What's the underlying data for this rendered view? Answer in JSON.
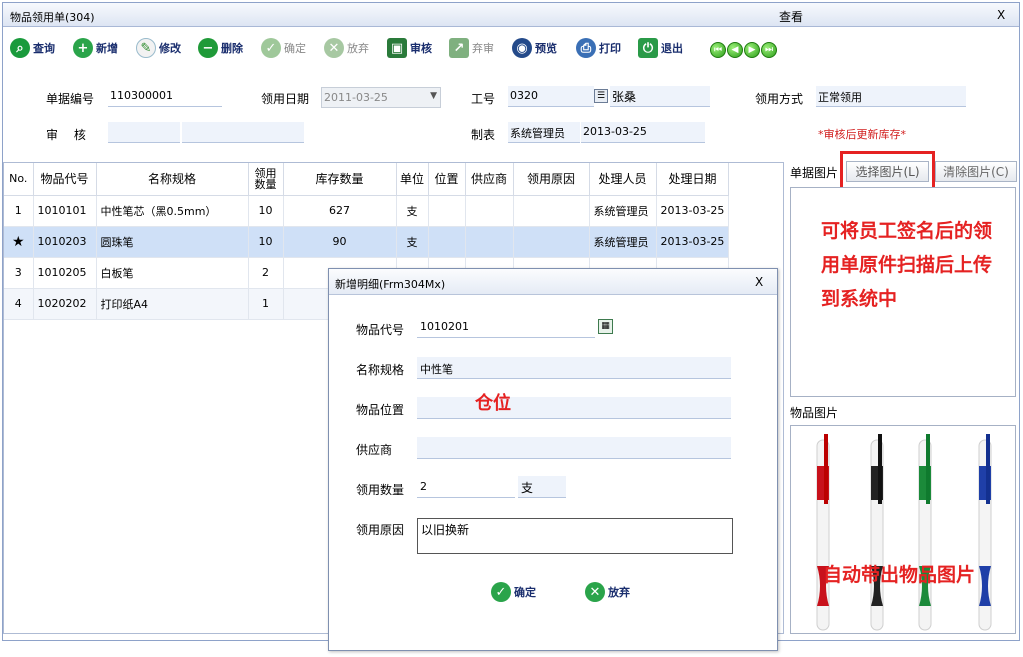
{
  "window": {
    "title": "物品领用单(304)",
    "mode": "查看",
    "close": "X"
  },
  "toolbar": {
    "query": "查询",
    "add": "新增",
    "edit": "修改",
    "delete": "删除",
    "confirm": "确定",
    "discard": "放弃",
    "audit": "审核",
    "unaudit": "弃审",
    "preview": "预览",
    "print": "打印",
    "exit": "退出"
  },
  "form": {
    "doc_no_label": "单据编号",
    "doc_no": "110300001",
    "date_label": "领用日期",
    "date": "2011-03-25",
    "emp_label": "工号",
    "emp_no": "0320",
    "emp_name": "张桑",
    "method_label": "领用方式",
    "method": "正常领用",
    "auditor_label": "审　 核",
    "creator_label": "制表",
    "creator": "系统管理员",
    "created": "2013-03-25",
    "note": "*审核后更新库存*"
  },
  "table": {
    "headers": [
      "No.",
      "物品代号",
      "名称规格",
      "领用数量",
      "库存数量",
      "单位",
      "位置",
      "供应商",
      "领用原因",
      "处理人员",
      "处理日期"
    ],
    "rows": [
      {
        "no": "1",
        "code": "1010101",
        "name": "中性笔芯（黑0.5mm）",
        "qty": "10",
        "stock": "627",
        "unit": "支",
        "pos": "",
        "supplier": "",
        "reason": "",
        "handler": "系统管理员",
        "date": "2013-03-25"
      },
      {
        "no": "★",
        "code": "1010203",
        "name": "圆珠笔",
        "qty": "10",
        "stock": "90",
        "unit": "支",
        "pos": "",
        "supplier": "",
        "reason": "",
        "handler": "系统管理员",
        "date": "2013-03-25"
      },
      {
        "no": "3",
        "code": "1010205",
        "name": "白板笔",
        "qty": "2",
        "stock": "",
        "unit": "",
        "pos": "",
        "supplier": "",
        "reason": "",
        "handler": "",
        "date": ""
      },
      {
        "no": "4",
        "code": "1020202",
        "name": "打印纸A4",
        "qty": "1",
        "stock": "",
        "unit": "",
        "pos": "",
        "supplier": "",
        "reason": "",
        "handler": "",
        "date": ""
      }
    ]
  },
  "side": {
    "doc_image_label": "单据图片",
    "select_image": "选择图片(L)",
    "clear_image": "清除图片(C)",
    "item_image_label": "物品图片",
    "anno_upload": "可将员工签名后的领用单原件扫描后上传到系统中",
    "anno_upload_lines": [
      "可将员工签名后的领",
      "用单原件扫描后上传",
      "到系统中"
    ],
    "anno_auto": "自动带出物品图片"
  },
  "dialog": {
    "title": "新增明细(Frm304Mx)",
    "close": "X",
    "code_label": "物品代号",
    "code": "1010201",
    "name_label": "名称规格",
    "name": "中性笔",
    "pos_label": "物品位置",
    "pos_anno": "仓位",
    "supplier_label": "供应商",
    "supplier": "",
    "qty_label": "领用数量",
    "qty": "2",
    "unit": "支",
    "reason_label": "领用原因",
    "reason": "以旧换新",
    "ok": "确定",
    "cancel": "放弃"
  },
  "colors": {
    "accent_red": "#e52222",
    "selected_row": "#cfe0f7",
    "toolbar_text": "#1a2e6e"
  }
}
